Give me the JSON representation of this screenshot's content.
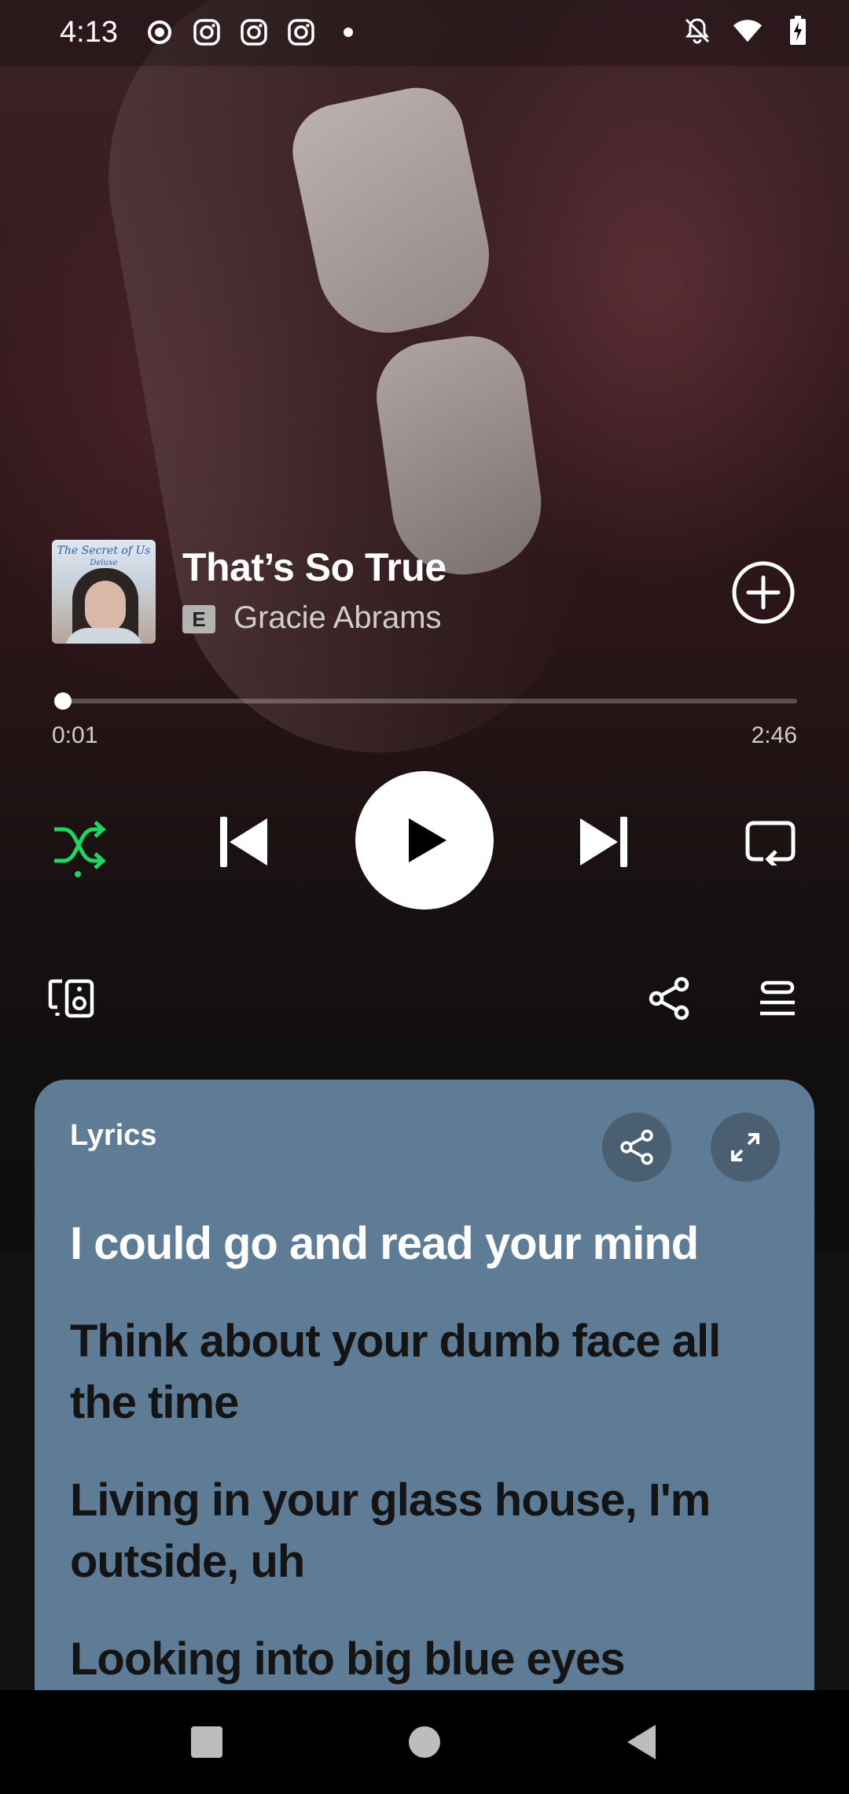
{
  "status_bar": {
    "time": "4:13"
  },
  "track": {
    "title": "That’s So True",
    "explicit_badge": "E",
    "artist": "Gracie Abrams",
    "album_art_title": "The Secret of Us",
    "album_art_subtitle": "Deluxe"
  },
  "playback": {
    "elapsed": "0:01",
    "total": "2:46",
    "progress_fraction": 0.006,
    "shuffle_active": true,
    "is_playing": false
  },
  "lyrics": {
    "label": "Lyrics",
    "lines": [
      "I could go and read your mind",
      "Think about your dumb face all the time",
      "Living in your glass house, I'm outside, uh",
      "Looking into big blue eyes"
    ]
  },
  "colors": {
    "accent_green": "#1ed760",
    "lyrics_card_bg": "#5e7c96",
    "upcoming_lyric": "#141414"
  },
  "icons": {
    "status_left": [
      "record-icon",
      "instagram-icon",
      "instagram-icon",
      "instagram-icon",
      "dot-icon"
    ],
    "status_right": [
      "bell-off-icon",
      "wifi-icon",
      "battery-charging-icon"
    ]
  }
}
